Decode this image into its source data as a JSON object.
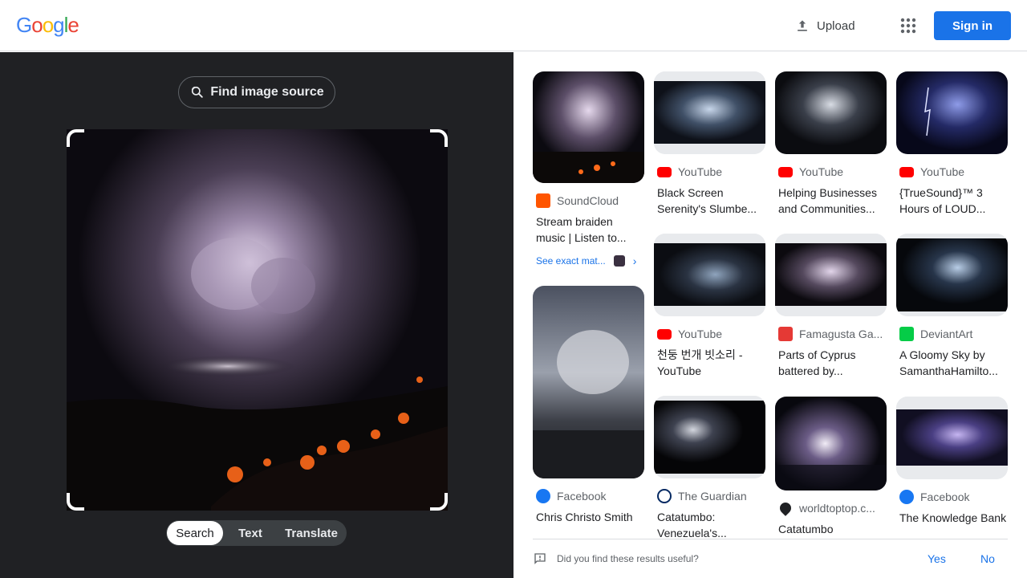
{
  "header": {
    "logo": "Google",
    "upload_label": "Upload",
    "signin_label": "Sign in",
    "logo_colors": [
      "#4285f4",
      "#ea4335",
      "#fbbc05",
      "#4285f4",
      "#34a853",
      "#ea4335"
    ]
  },
  "left": {
    "find_source_label": "Find image source",
    "modes": [
      "Search",
      "Text",
      "Translate"
    ],
    "active_mode": "Search"
  },
  "results": [
    {
      "source": "SoundCloud",
      "icon": "soundcloud-icon",
      "title": "Stream braiden music | Listen to...",
      "exact": "See exact mat..."
    },
    {
      "source": "YouTube",
      "icon": "youtube-icon",
      "title": "Black Screen Serenity's Slumbe..."
    },
    {
      "source": "YouTube",
      "icon": "youtube-icon",
      "title": "Helping Businesses and Communities..."
    },
    {
      "source": "YouTube",
      "icon": "youtube-icon",
      "title": "{TrueSound}™ 3 Hours of LOUD..."
    },
    {
      "source": "YouTube",
      "icon": "youtube-icon",
      "title": "천둥 번개 빗소리 - YouTube"
    },
    {
      "source": "Famagusta Ga...",
      "icon": "famagusta-icon",
      "title": "Parts of Cyprus battered by..."
    },
    {
      "source": "DeviantArt",
      "icon": "deviantart-icon",
      "title": "A Gloomy Sky by SamanthaHamilto..."
    },
    {
      "source": "Facebook",
      "icon": "facebook-icon",
      "title": "Chris Christo Smith"
    },
    {
      "source": "The Guardian",
      "icon": "guardian-icon",
      "title": "Catatumbo: Venezuela's..."
    },
    {
      "source": "worldtoptop.c...",
      "icon": "map-pin-icon",
      "title": "Catatumbo"
    },
    {
      "source": "Facebook",
      "icon": "facebook-icon",
      "title": "The Knowledge Bank"
    }
  ],
  "feedback": {
    "question": "Did you find these results useful?",
    "yes": "Yes",
    "no": "No"
  },
  "colors": {
    "accent": "#1a73e8",
    "left_bg": "#202124",
    "youtube": "#ff0000",
    "soundcloud": "#ff5500",
    "facebook": "#1877f2",
    "deviantart": "#05cc47"
  }
}
